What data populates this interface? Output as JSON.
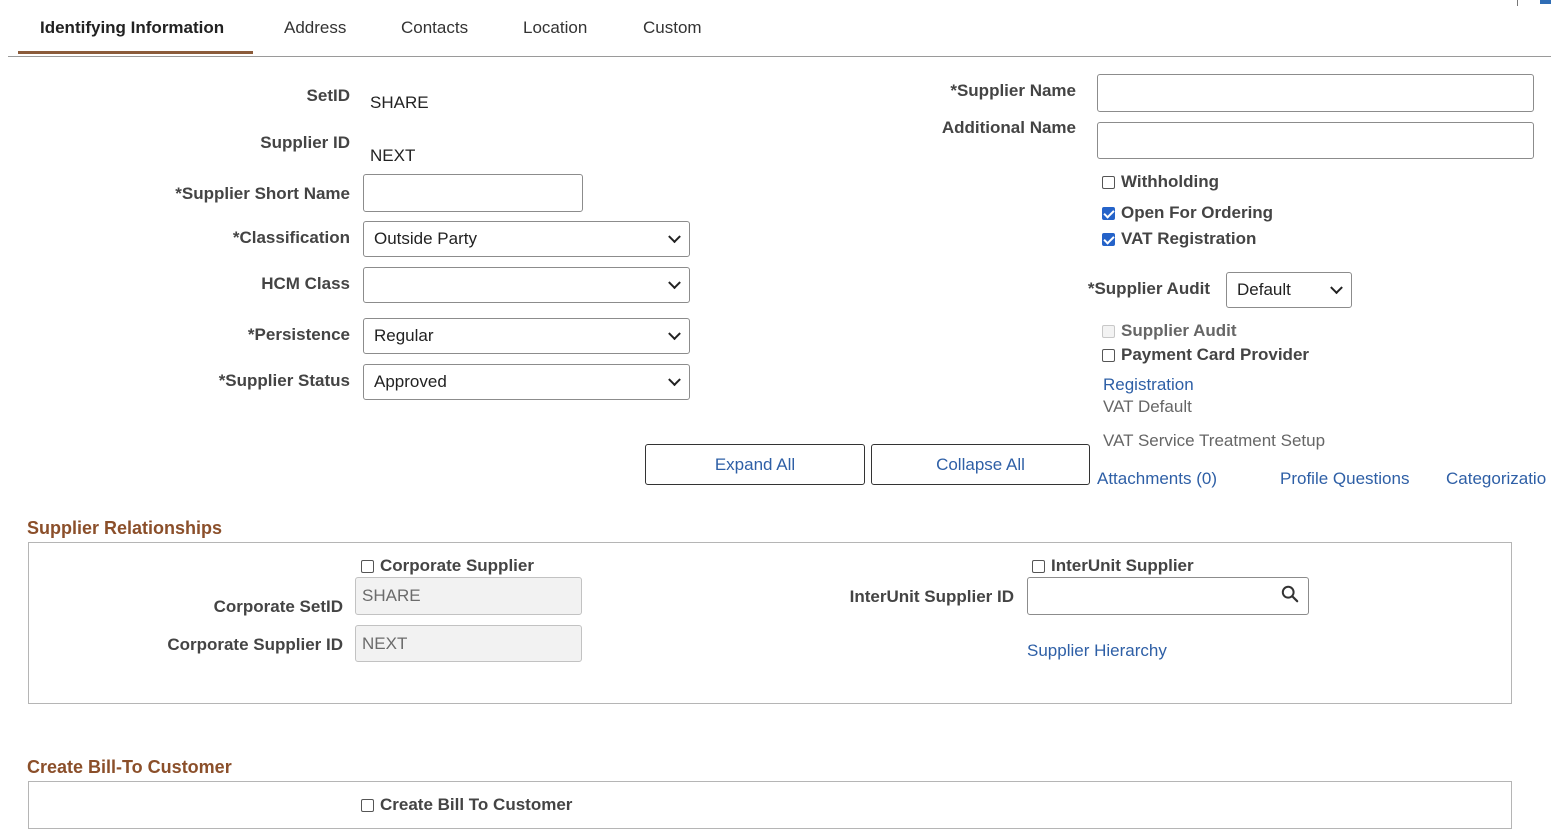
{
  "tabs": [
    {
      "label": "Identifying Information",
      "active": true
    },
    {
      "label": "Address",
      "active": false
    },
    {
      "label": "Contacts",
      "active": false
    },
    {
      "label": "Location",
      "active": false
    },
    {
      "label": "Custom",
      "active": false
    }
  ],
  "left_fields": {
    "setid_label": "SetID",
    "setid_value": "SHARE",
    "supplier_id_label": "Supplier ID",
    "supplier_id_value": "NEXT",
    "short_name_label": "*Supplier Short Name",
    "short_name_value": "",
    "classification_label": "*Classification",
    "classification_value": "Outside Party",
    "hcm_class_label": "HCM Class",
    "hcm_class_value": "",
    "persistence_label": "*Persistence",
    "persistence_value": "Regular",
    "status_label": "*Supplier Status",
    "status_value": "Approved"
  },
  "right_fields": {
    "supplier_name_label": "*Supplier Name",
    "supplier_name_value": "",
    "additional_name_label": "Additional Name",
    "additional_name_value": "",
    "withholding_label": "Withholding",
    "withholding_checked": false,
    "open_for_ordering_label": "Open For Ordering",
    "open_for_ordering_checked": true,
    "vat_registration_label": "VAT Registration",
    "vat_registration_checked": true,
    "supplier_audit_select_label": "*Supplier Audit",
    "supplier_audit_select_value": "Default",
    "supplier_audit_cb_label": "Supplier Audit",
    "payment_card_label": "Payment Card Provider",
    "registration_link": "Registration",
    "vat_default_text": "VAT Default",
    "vat_service_text": "VAT Service Treatment Setup"
  },
  "buttons": {
    "expand_all": "Expand All",
    "collapse_all": "Collapse All"
  },
  "links": {
    "attachments": "Attachments (0)",
    "profile_questions": "Profile Questions",
    "categorization": "Categorizatio"
  },
  "supplier_relationships": {
    "title": "Supplier Relationships",
    "corporate_supplier_label": "Corporate Supplier",
    "corporate_setid_label": "Corporate SetID",
    "corporate_setid_value": "SHARE",
    "corporate_supplier_id_label": "Corporate Supplier ID",
    "corporate_supplier_id_value": "NEXT",
    "interunit_supplier_label": "InterUnit Supplier",
    "interunit_supplier_id_label": "InterUnit Supplier ID",
    "interunit_supplier_id_value": "",
    "supplier_hierarchy_link": "Supplier Hierarchy"
  },
  "bill_to": {
    "title": "Create Bill-To Customer",
    "create_bill_to_label": "Create Bill To Customer"
  },
  "colors": {
    "accent_brown": "#8b4f2a",
    "link_blue": "#2e5fa6",
    "checkbox_blue": "#2563c9"
  }
}
